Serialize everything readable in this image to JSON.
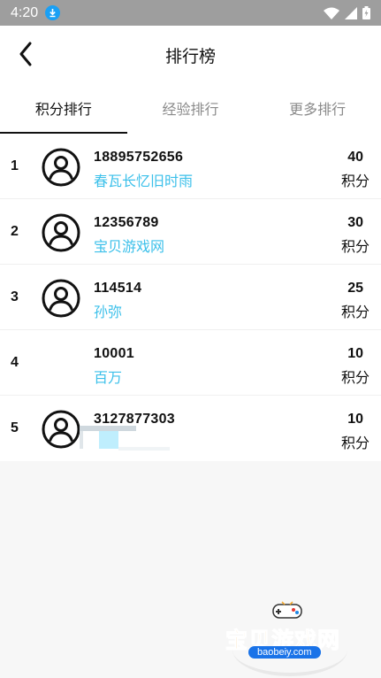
{
  "status_bar": {
    "time": "4:20",
    "download_icon": "download-icon",
    "wifi_icon": "wifi-icon",
    "signal_icon": "signal-icon",
    "battery_icon": "battery-icon"
  },
  "header": {
    "title": "排行榜",
    "back_icon": "back-arrow-icon"
  },
  "tabs": [
    {
      "label": "积分排行",
      "active": true
    },
    {
      "label": "经验排行",
      "active": false
    },
    {
      "label": "更多排行",
      "active": false
    }
  ],
  "leaderboard": [
    {
      "rank": "1",
      "uid": "18895752656",
      "nickname": "春瓦长忆旧时雨",
      "score": "40",
      "unit": "积分",
      "has_avatar": true
    },
    {
      "rank": "2",
      "uid": "12356789",
      "nickname": "宝贝游戏网",
      "score": "30",
      "unit": "积分",
      "has_avatar": true
    },
    {
      "rank": "3",
      "uid": "114514",
      "nickname": "孙弥",
      "score": "25",
      "unit": "积分",
      "has_avatar": true
    },
    {
      "rank": "4",
      "uid": "10001",
      "nickname": "百万",
      "score": "10",
      "unit": "积分",
      "has_avatar": false
    },
    {
      "rank": "5",
      "uid": "3127877303",
      "nickname": "",
      "score": "10",
      "unit": "积分",
      "has_avatar": true
    }
  ],
  "watermark": {
    "text": "宝贝游戏网",
    "url": "baobeiy.com"
  },
  "colors": {
    "accent": "#3cc0ea",
    "status_bar": "#9e9e9e",
    "download_badge": "#1aa0f5"
  }
}
